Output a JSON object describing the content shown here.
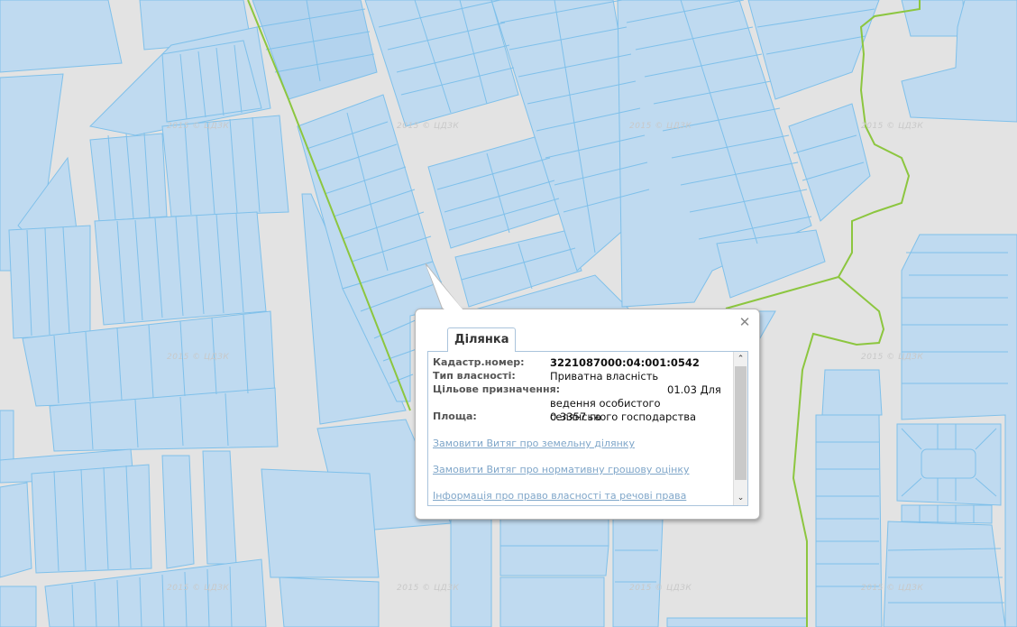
{
  "map": {
    "watermark": "2015 © ЦДЗК",
    "colors": {
      "background": "#e3e3e3",
      "parcel_fill": "#bfdaf0",
      "parcel_stroke": "#7fc0ea",
      "boundary": "#8cc63f"
    }
  },
  "popup": {
    "tab_label": "Ділянка",
    "close_icon": "close-icon",
    "fields": [
      {
        "label": "Кадастр.номер:",
        "value": "3221087000:04:001:0542"
      },
      {
        "label": "Тип власності:",
        "value": "Приватна власність"
      },
      {
        "label": "Цільове призначення:",
        "value": "01.03 Для ведення особистого селянського господарства"
      },
      {
        "label": "Площа:",
        "value": "0.3357 га"
      }
    ],
    "links": [
      "Замовити Витяг про земельну ділянку",
      "Замовити Витяг про нормативну грошову оцінку",
      "Інформація про право власності та речові права"
    ]
  }
}
